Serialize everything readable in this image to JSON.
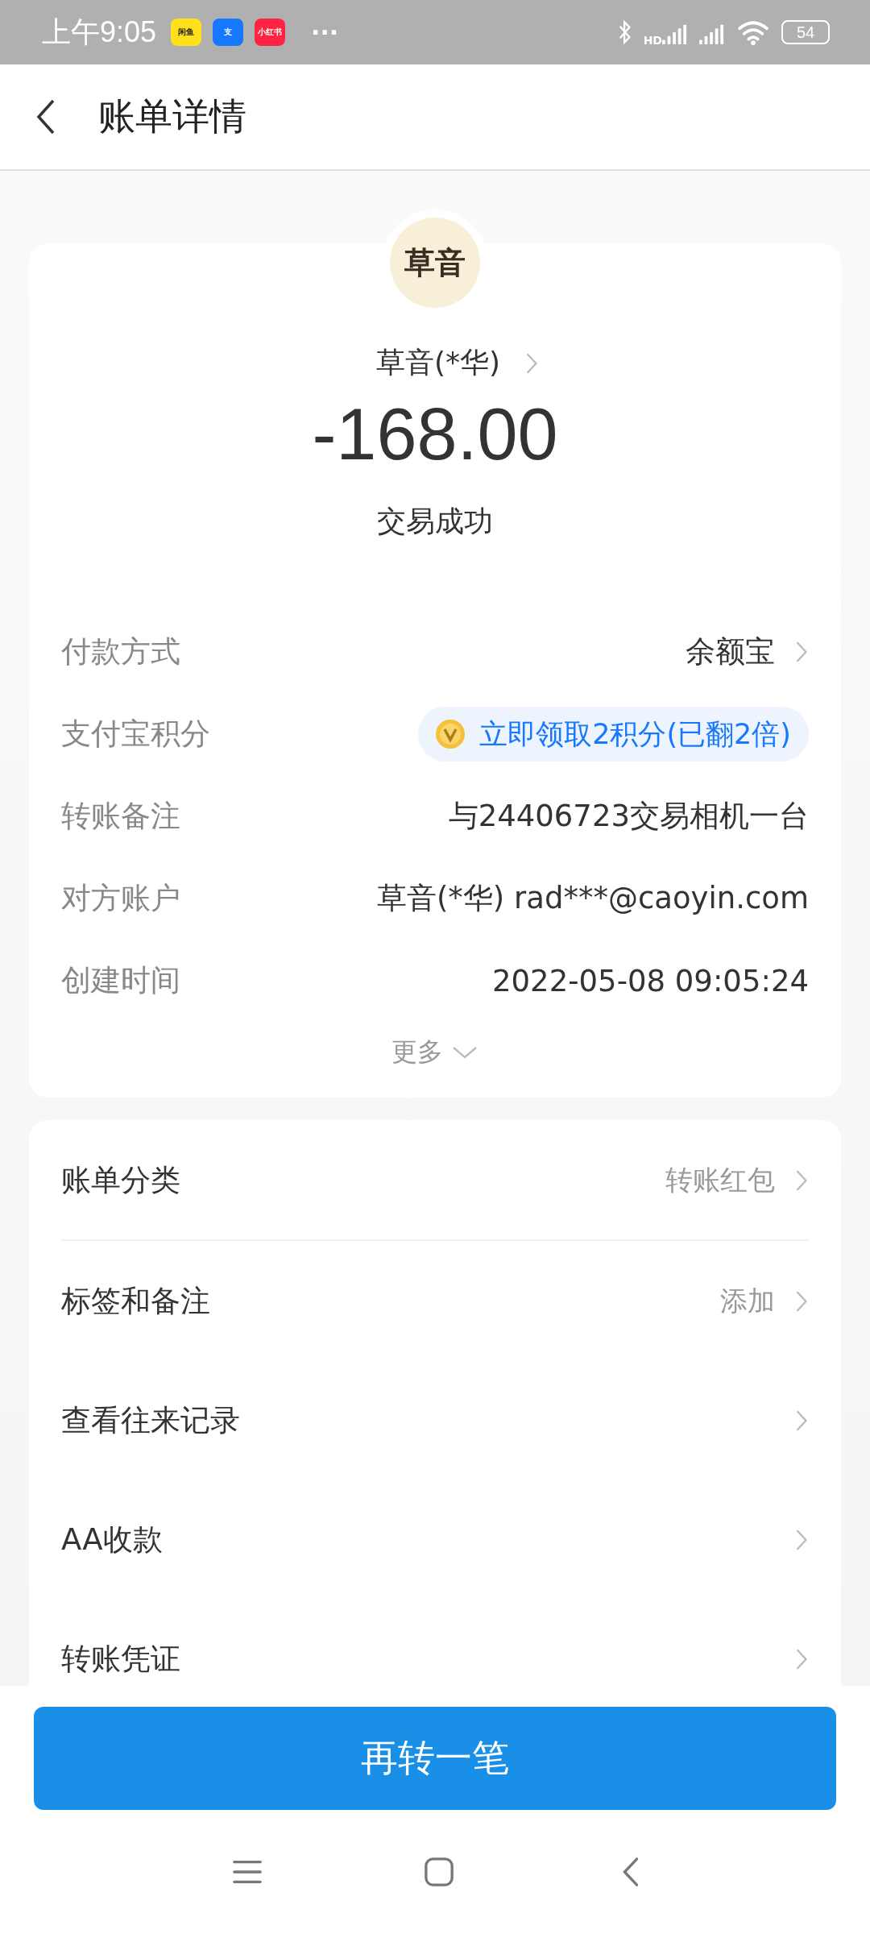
{
  "status_bar": {
    "time": "上午9:05",
    "app_icons": [
      {
        "label": "闲鱼",
        "color": "#ffe01b"
      },
      {
        "label": "支",
        "color": "#1677ff"
      },
      {
        "label": "小红书",
        "color": "#ff2442"
      }
    ],
    "more": "···",
    "network": "HD",
    "battery": "54"
  },
  "header": {
    "title": "账单详情"
  },
  "summary": {
    "logo_text": "草音",
    "payee": "草音(*华)",
    "amount": "-168.00",
    "status": "交易成功"
  },
  "details": [
    {
      "kind": "text",
      "label": "付款方式",
      "value": "余额宝",
      "chevron": true
    },
    {
      "kind": "badge",
      "label": "支付宝积分",
      "value": "立即领取2积分(已翻2倍)",
      "chevron": false
    },
    {
      "kind": "text",
      "label": "转账备注",
      "value": "与24406723交易相机一台",
      "chevron": false
    },
    {
      "kind": "text",
      "label": "对方账户",
      "value": "草音(*华) rad***@caoyin.com",
      "chevron": false
    },
    {
      "kind": "text",
      "label": "创建时间",
      "value": "2022-05-08 09:05:24",
      "chevron": false
    }
  ],
  "more_link": "更多",
  "actions": [
    {
      "label": "账单分类",
      "value": "转账红包"
    },
    {
      "label": "标签和备注",
      "value": "添加"
    },
    {
      "label": "查看往来记录"
    },
    {
      "label": "AA收款"
    },
    {
      "label": "转账凭证"
    }
  ],
  "primary_button": "再转一笔"
}
